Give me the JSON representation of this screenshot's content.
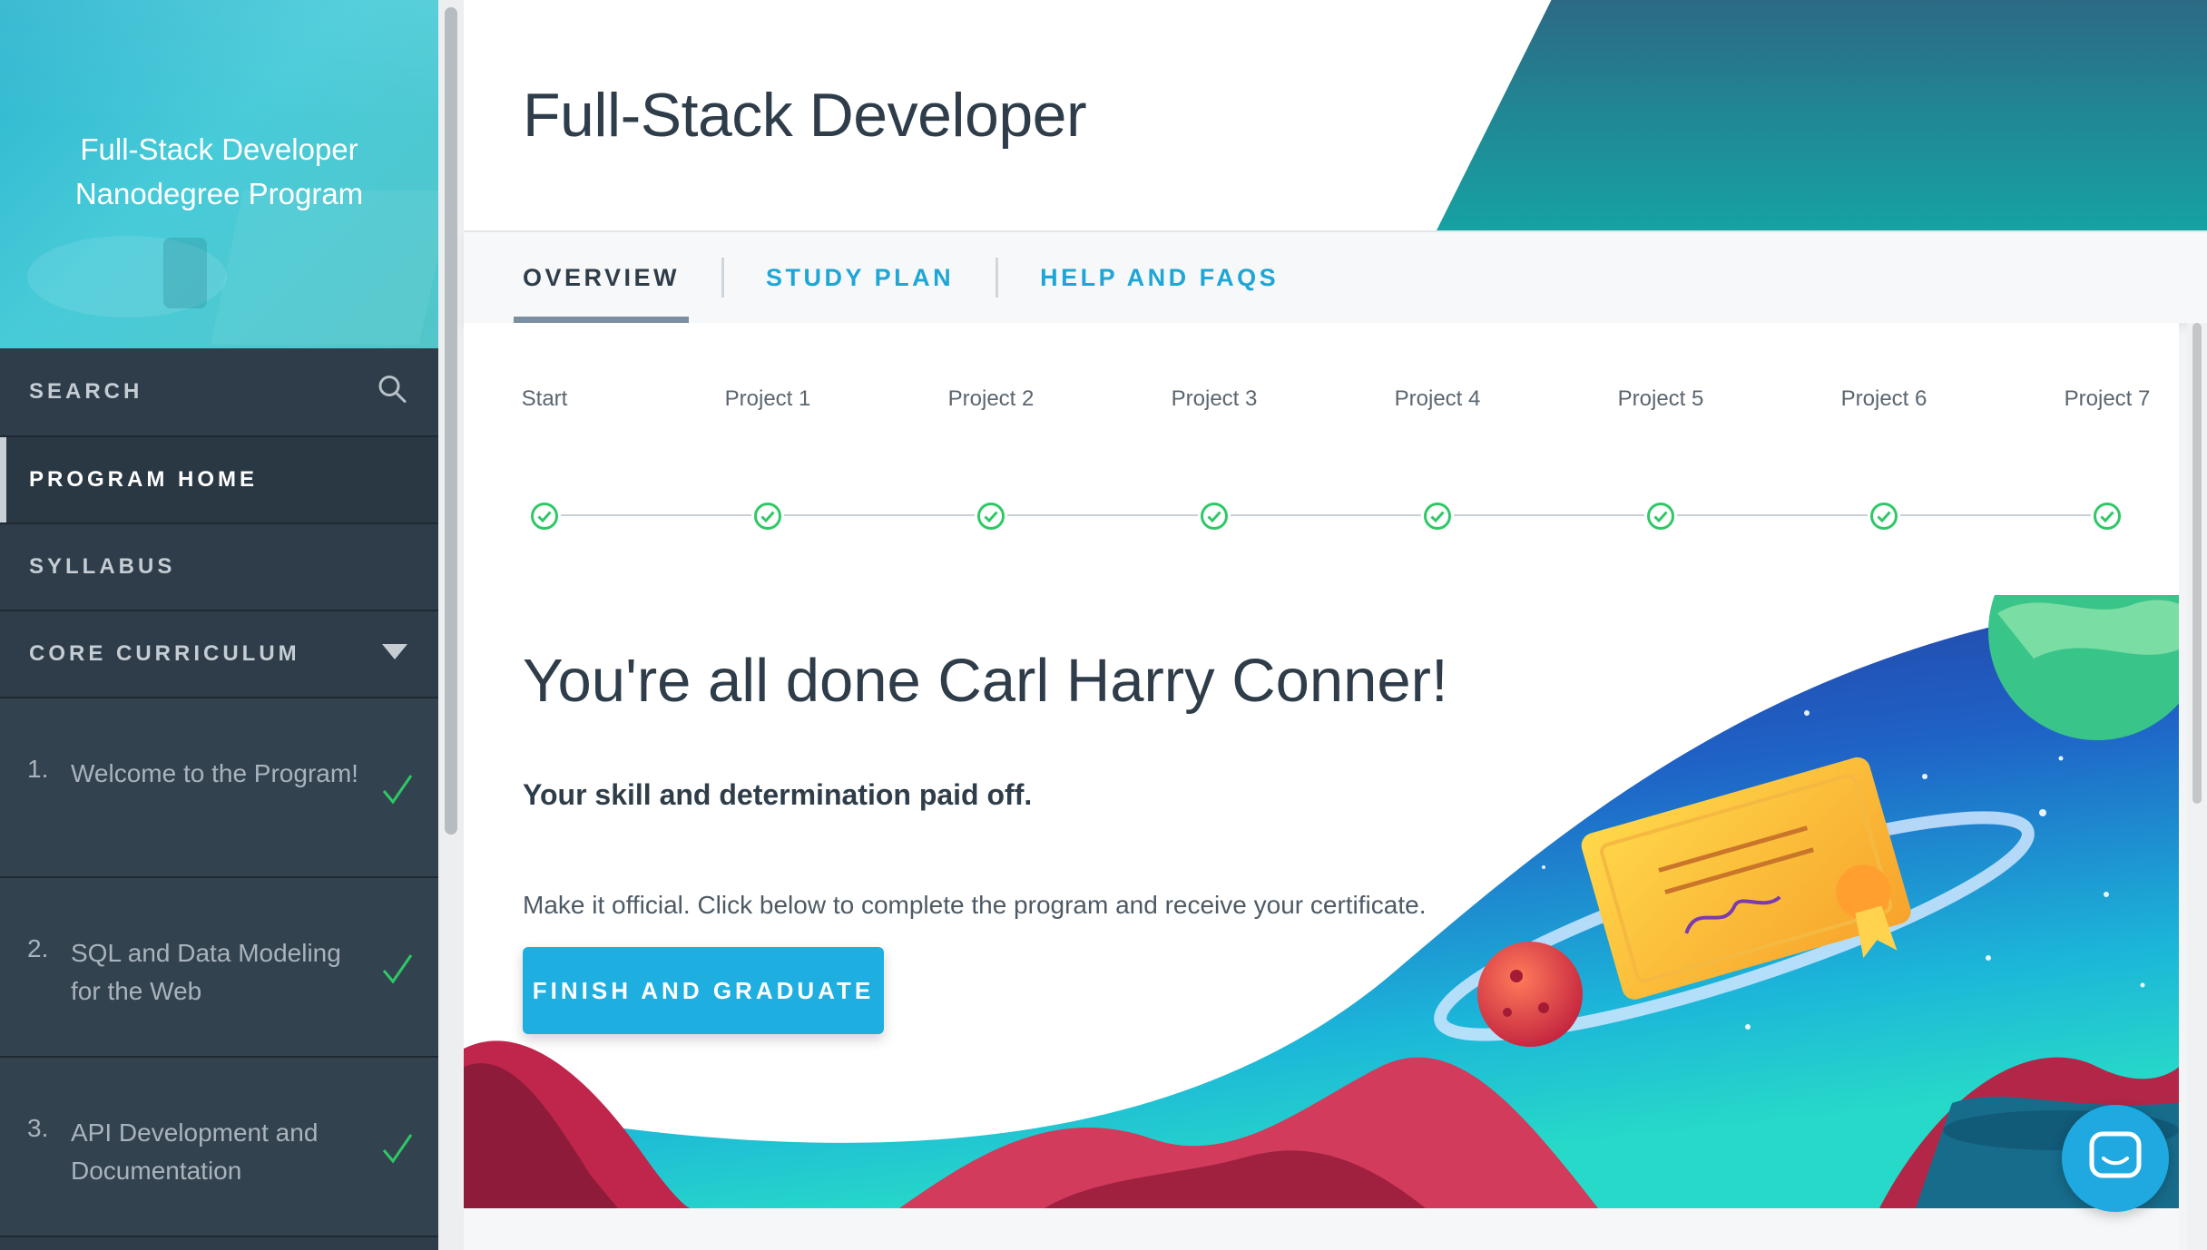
{
  "sidebar": {
    "program_title_line1": "Full-Stack Developer",
    "program_title_line2": "Nanodegree Program",
    "search_label": "SEARCH",
    "nav": {
      "program_home": "PROGRAM HOME",
      "syllabus": "SYLLABUS",
      "core_curriculum": "CORE CURRICULUM"
    },
    "lessons": [
      {
        "num": "1.",
        "title": "Welcome to the Program!",
        "completed": true
      },
      {
        "num": "2.",
        "title": "SQL and Data Modeling for the Web",
        "completed": true
      },
      {
        "num": "3.",
        "title": "API Development and Documentation",
        "completed": true
      }
    ]
  },
  "header": {
    "title": "Full-Stack Developer"
  },
  "tabs": {
    "overview": "OVERVIEW",
    "study_plan": "STUDY PLAN",
    "help": "HELP AND FAQS"
  },
  "progress": {
    "steps": [
      "Start",
      "Project 1",
      "Project 2",
      "Project 3",
      "Project 4",
      "Project 5",
      "Project 6",
      "Project 7"
    ],
    "completed": 8
  },
  "completion": {
    "heading": "You're all done Carl Harry Conner!",
    "subheading": "Your skill and determination paid off.",
    "text": "Make it official. Click below to complete the program and receive your certificate.",
    "button": "FINISH AND GRADUATE"
  },
  "colors": {
    "accent": "#1eaee0",
    "sidebar_bg": "#2e3d49",
    "success": "#02b3e4",
    "check_green": "#2ec866"
  },
  "icons": {
    "search": "search-icon",
    "dropdown": "triangle-down-icon",
    "check": "checkmark-icon",
    "step_done": "check-circle-icon",
    "chat": "chat-icon"
  }
}
